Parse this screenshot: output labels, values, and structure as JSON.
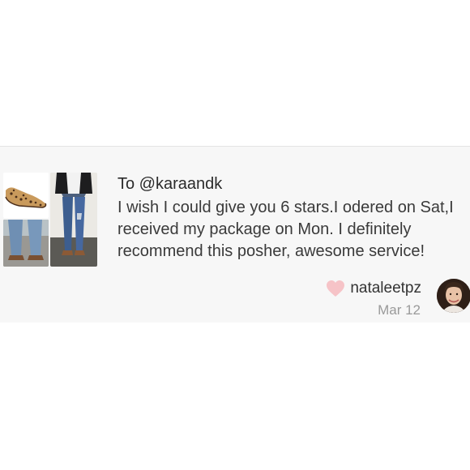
{
  "comment": {
    "recipient": "To @karaandk",
    "message": "I wish I could give you 6 stars.I odered on Sat,I received my package on Mon. I definitely recommend this posher, awesome service!",
    "author": "nataleetpz",
    "date": "Mar 12"
  },
  "icons": {
    "heart": "heart-icon"
  },
  "colors": {
    "heart": "#f6c3c7",
    "card_background": "#f7f7f7"
  }
}
